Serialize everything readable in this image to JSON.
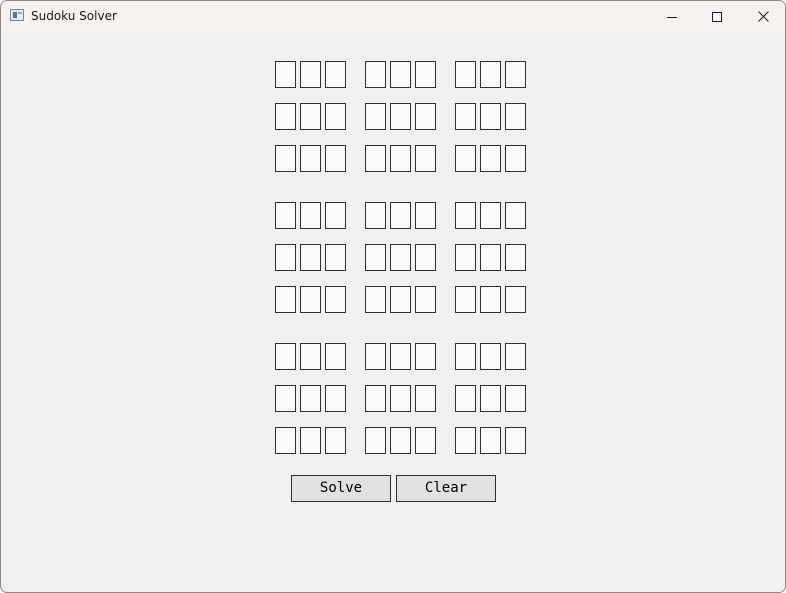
{
  "window": {
    "title": "Sudoku Solver"
  },
  "controls": {
    "minimize_icon": "minimize-icon",
    "maximize_icon": "maximize-icon",
    "close_icon": "close-icon"
  },
  "board": {
    "cells": [
      [
        "",
        "",
        "",
        "",
        "",
        "",
        "",
        "",
        ""
      ],
      [
        "",
        "",
        "",
        "",
        "",
        "",
        "",
        "",
        ""
      ],
      [
        "",
        "",
        "",
        "",
        "",
        "",
        "",
        "",
        ""
      ],
      [
        "",
        "",
        "",
        "",
        "",
        "",
        "",
        "",
        ""
      ],
      [
        "",
        "",
        "",
        "",
        "",
        "",
        "",
        "",
        ""
      ],
      [
        "",
        "",
        "",
        "",
        "",
        "",
        "",
        "",
        ""
      ],
      [
        "",
        "",
        "",
        "",
        "",
        "",
        "",
        "",
        ""
      ],
      [
        "",
        "",
        "",
        "",
        "",
        "",
        "",
        "",
        ""
      ],
      [
        "",
        "",
        "",
        "",
        "",
        "",
        "",
        "",
        ""
      ]
    ]
  },
  "actions": {
    "solve_label": "Solve",
    "clear_label": "Clear"
  },
  "colors": {
    "window_bg": "#f0f0f0",
    "titlebar_bg": "#f7f2ef",
    "cell_border": "#303030",
    "button_bg": "#e1e1e1"
  }
}
